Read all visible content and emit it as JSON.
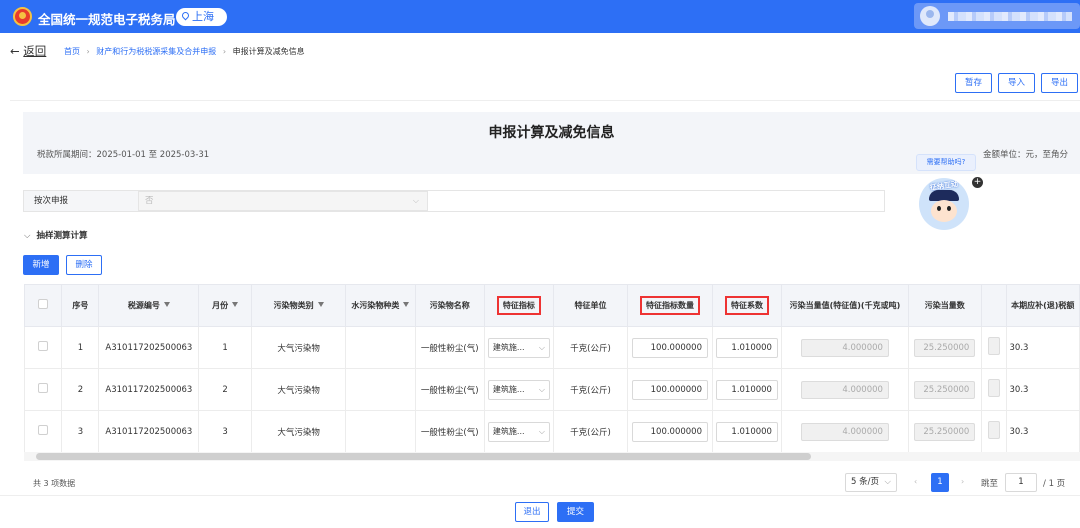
{
  "app": {
    "title": "全国统一规范电子税务局",
    "region": "上海"
  },
  "nav": {
    "back_label": "返回",
    "breadcrumb": {
      "home": "首页",
      "sep": "›",
      "parent": "财产和行为税税源采集及合并申报",
      "current": "申报计算及减免信息"
    }
  },
  "toolbar": {
    "save_draft": "暂存",
    "import": "导入",
    "export": "导出"
  },
  "header": {
    "title": "申报计算及减免信息",
    "period": "税款所属期间：2025-01-01 至 2025-03-31",
    "unit": "金额单位：元，至角分"
  },
  "assistant": {
    "bubble": "需要帮助吗?",
    "label": "征纳互动",
    "plus": "+"
  },
  "form": {
    "label": "按次申报",
    "value": "否"
  },
  "section": {
    "title": "抽样测算计算"
  },
  "actions": {
    "add": "新增",
    "delete": "删除"
  },
  "table": {
    "headers": [
      "序号",
      "税源编号",
      "月份",
      "污染物类别",
      "水污染物种类",
      "污染物名称",
      "特征指标",
      "特征单位",
      "特征指标数量",
      "特征系数",
      "污染当量值(特征值)(千克或吨)",
      "污染当量数",
      "本期应补(退)税额"
    ],
    "rows": [
      {
        "index": "1",
        "source_id": "A310117202500063",
        "month": "1",
        "category": "大气污染物",
        "water_type": "",
        "pollutant": "一般性粉尘(气)",
        "indicator": "建筑施...",
        "unit": "千克(公斤)",
        "quantity": "100.000000",
        "coefficient": "1.010000",
        "equivalent_value": "4.000000",
        "equivalent_count": "25.250000",
        "tax": "30.3"
      },
      {
        "index": "2",
        "source_id": "A310117202500063",
        "month": "2",
        "category": "大气污染物",
        "water_type": "",
        "pollutant": "一般性粉尘(气)",
        "indicator": "建筑施...",
        "unit": "千克(公斤)",
        "quantity": "100.000000",
        "coefficient": "1.010000",
        "equivalent_value": "4.000000",
        "equivalent_count": "25.250000",
        "tax": "30.3"
      },
      {
        "index": "3",
        "source_id": "A310117202500063",
        "month": "3",
        "category": "大气污染物",
        "water_type": "",
        "pollutant": "一般性粉尘(气)",
        "indicator": "建筑施...",
        "unit": "千克(公斤)",
        "quantity": "100.000000",
        "coefficient": "1.010000",
        "equivalent_value": "4.000000",
        "equivalent_count": "25.250000",
        "tax": "30.3"
      }
    ]
  },
  "pagination": {
    "total": "共 3 项数据",
    "page_size": "5 条/页",
    "current_page": "1",
    "jump_label": "跳至",
    "jump_value": "1",
    "total_pages": "/ 1 页"
  },
  "footer": {
    "exit": "退出",
    "submit": "提交"
  },
  "colors": {
    "primary": "#2d6ff5",
    "highlight_border": "#ee3333",
    "header_bg": "#f3f5f9"
  }
}
